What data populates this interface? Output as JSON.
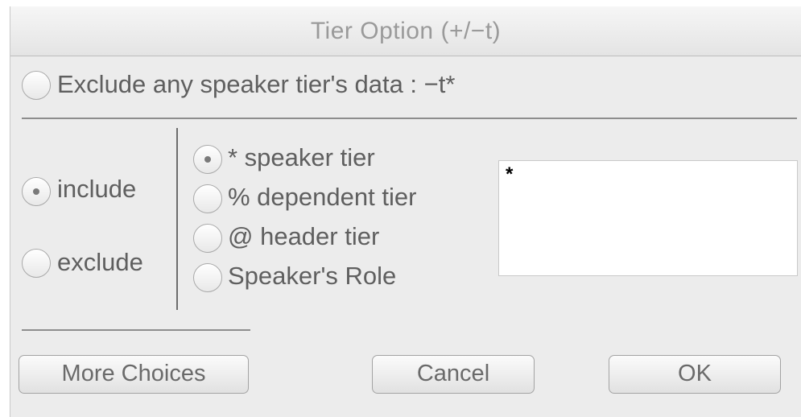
{
  "window": {
    "title": "Tier Option (+/−t)"
  },
  "exclude_all": {
    "label": "Exclude any speaker tier's data : −t*",
    "selected": false
  },
  "mode": {
    "options": [
      {
        "label": "include",
        "selected": true
      },
      {
        "label": "exclude",
        "selected": false
      }
    ]
  },
  "tier_type": {
    "options": [
      {
        "label": "* speaker tier",
        "selected": true
      },
      {
        "label": "% dependent tier",
        "selected": false
      },
      {
        "label": "@ header tier",
        "selected": false
      },
      {
        "label": "Speaker's Role",
        "selected": false
      }
    ]
  },
  "tier_input": {
    "value": "*"
  },
  "buttons": {
    "more_choices": "More Choices",
    "cancel": "Cancel",
    "ok": "OK"
  }
}
